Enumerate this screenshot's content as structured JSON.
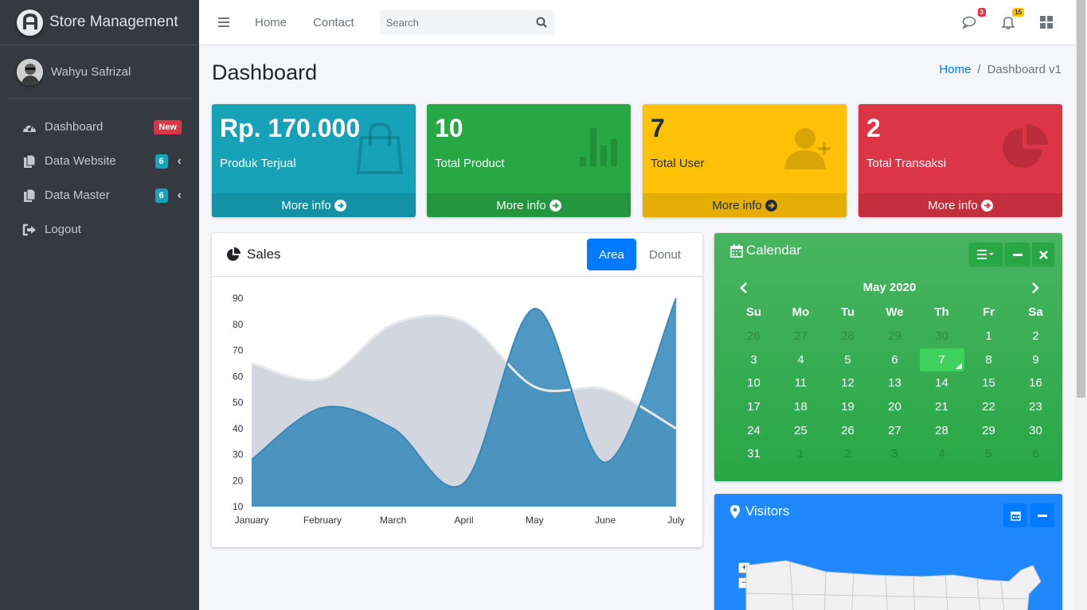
{
  "brand": {
    "title": "Store Management"
  },
  "user": {
    "name": "Wahyu Safrizal"
  },
  "sidebar": {
    "items": [
      {
        "label": "Dashboard",
        "badge": "New",
        "icon": "tachometer-icon"
      },
      {
        "label": "Data Website",
        "badge": "6",
        "icon": "copy-icon"
      },
      {
        "label": "Data Master",
        "badge": "6",
        "icon": "copy-icon"
      },
      {
        "label": "Logout",
        "icon": "sign-out-icon"
      }
    ]
  },
  "topbar": {
    "links": [
      "Home",
      "Contact"
    ],
    "search_placeholder": "Search",
    "messages_count": "3",
    "notifications_count": "15"
  },
  "header": {
    "title": "Dashboard",
    "breadcrumb": {
      "home": "Home",
      "separator": "/",
      "current": "Dashboard v1"
    }
  },
  "stats": [
    {
      "value": "Rp. 170.000",
      "label": "Produk Terjual",
      "footer": "More info",
      "color": "#17a2b8",
      "icon": "shopping-bag-icon"
    },
    {
      "value": "10",
      "label": "Total Product",
      "footer": "More info",
      "color": "#28a745",
      "icon": "bar-chart-icon"
    },
    {
      "value": "7",
      "label": "Total User",
      "footer": "More info",
      "color": "#ffc107",
      "icon": "user-plus-icon"
    },
    {
      "value": "2",
      "label": "Total Transaksi",
      "footer": "More info",
      "color": "#dc3545",
      "icon": "pie-chart-icon"
    }
  ],
  "sales": {
    "title": "Sales",
    "tabs": [
      "Area",
      "Donut"
    ],
    "active_tab": "Area"
  },
  "chart_data": {
    "type": "area",
    "categories": [
      "January",
      "February",
      "March",
      "April",
      "May",
      "June",
      "July"
    ],
    "yticks": [
      10,
      20,
      30,
      40,
      50,
      60,
      70,
      80,
      90
    ],
    "ylim": [
      10,
      90
    ],
    "series": [
      {
        "values": [
          65,
          59,
          80,
          81,
          56,
          55,
          40
        ],
        "color": "#d2d6de"
      },
      {
        "values": [
          28,
          48,
          40,
          19,
          86,
          27,
          90
        ],
        "color": "#3c8dbc"
      }
    ]
  },
  "calendar": {
    "title": "Calendar",
    "month": "May 2020",
    "weekdays": [
      "Su",
      "Mo",
      "Tu",
      "We",
      "Th",
      "Fr",
      "Sa"
    ],
    "weeks": [
      [
        "26",
        "27",
        "28",
        "29",
        "30",
        "1",
        "2"
      ],
      [
        "3",
        "4",
        "5",
        "6",
        "7",
        "8",
        "9"
      ],
      [
        "10",
        "11",
        "12",
        "13",
        "14",
        "15",
        "16"
      ],
      [
        "17",
        "18",
        "19",
        "20",
        "21",
        "22",
        "23"
      ],
      [
        "24",
        "25",
        "26",
        "27",
        "28",
        "29",
        "30"
      ],
      [
        "31",
        "1",
        "2",
        "3",
        "4",
        "5",
        "6"
      ]
    ],
    "today": "7"
  },
  "visitors": {
    "title": "Visitors"
  }
}
